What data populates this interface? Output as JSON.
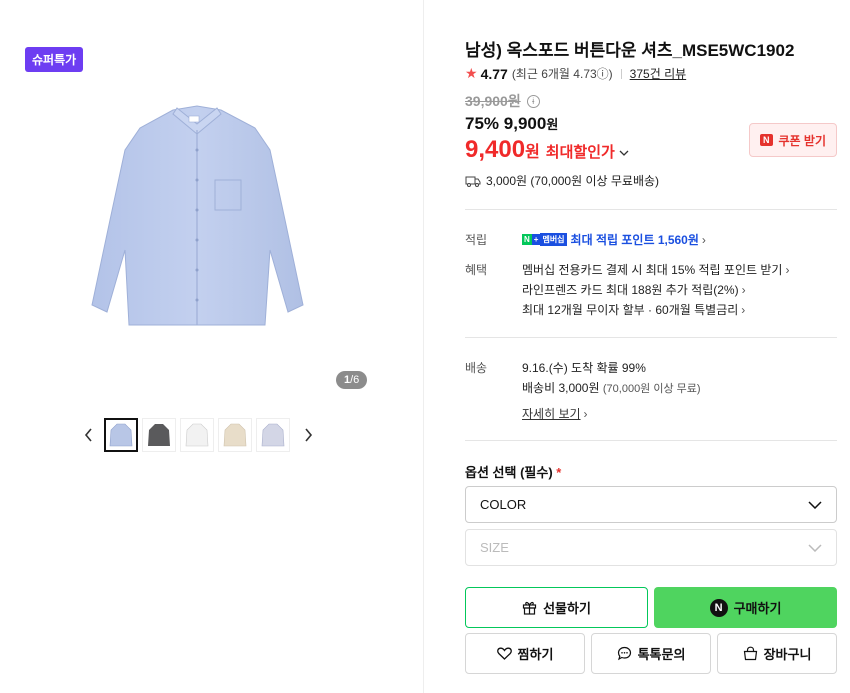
{
  "gallery": {
    "badge": "슈퍼특가",
    "page_current": "1",
    "page_total": "/6",
    "prev_icon": "chevron-left-icon",
    "next_icon": "chevron-right-icon",
    "thumbnails": [
      {
        "color": "#b8c6e6",
        "active": true
      },
      {
        "color": "#5a5a5c",
        "active": false
      },
      {
        "color": "#f2f2f2",
        "active": false
      },
      {
        "color": "#e8ddc9",
        "active": false
      },
      {
        "color": "#d3d6e6",
        "active": false
      }
    ]
  },
  "product": {
    "title": "남성) 옥스포드 버튼다운 셔츠_MSE5WC1902",
    "rating": "4.77",
    "rating_sub": "(최근 6개월 4.73ⓘ)",
    "review_count": "375건 리뷰",
    "original_price": "39,900원",
    "discount_rate": "75%",
    "sale_price": "9,900",
    "sale_unit": "원",
    "max_price": "9,400",
    "max_unit": "원",
    "max_label": "최대할인가",
    "coupon_label": "쿠폰 받기",
    "shipping_fee": "3,000원 (70,000원 이상 무료배송)"
  },
  "benefits": {
    "point_label": "적립",
    "point_badge": "멤버십",
    "point_text": "최대 적립 포인트 1,560원",
    "benefit_label": "혜택",
    "lines": [
      "멤버십 전용카드 결제 시 최대 15% 적립 포인트 받기",
      "라인프렌즈 카드 최대 188원 추가 적립(2%)",
      "최대 12개월 무이자 할부 · 60개월 특별금리"
    ]
  },
  "delivery": {
    "label": "배송",
    "eta": "9.16.(수) 도착 확률 99%",
    "fee": "배송비 3,000원",
    "fee_note": "(70,000원 이상 무료)",
    "detail_link": "자세히 보기"
  },
  "options": {
    "title": "옵션 선택 (필수)",
    "required_mark": "*",
    "color_select": "COLOR",
    "size_select": "SIZE"
  },
  "actions": {
    "gift": "선물하기",
    "buy": "구매하기",
    "wish": "찜하기",
    "talk": "톡톡문의",
    "cart": "장바구니"
  },
  "colors": {
    "accent_red": "#f02a2a",
    "naver_green": "#03c75a",
    "buy_button": "#4fd45f",
    "badge_purple": "#6d3df2",
    "point_blue": "#1a4fe0"
  }
}
